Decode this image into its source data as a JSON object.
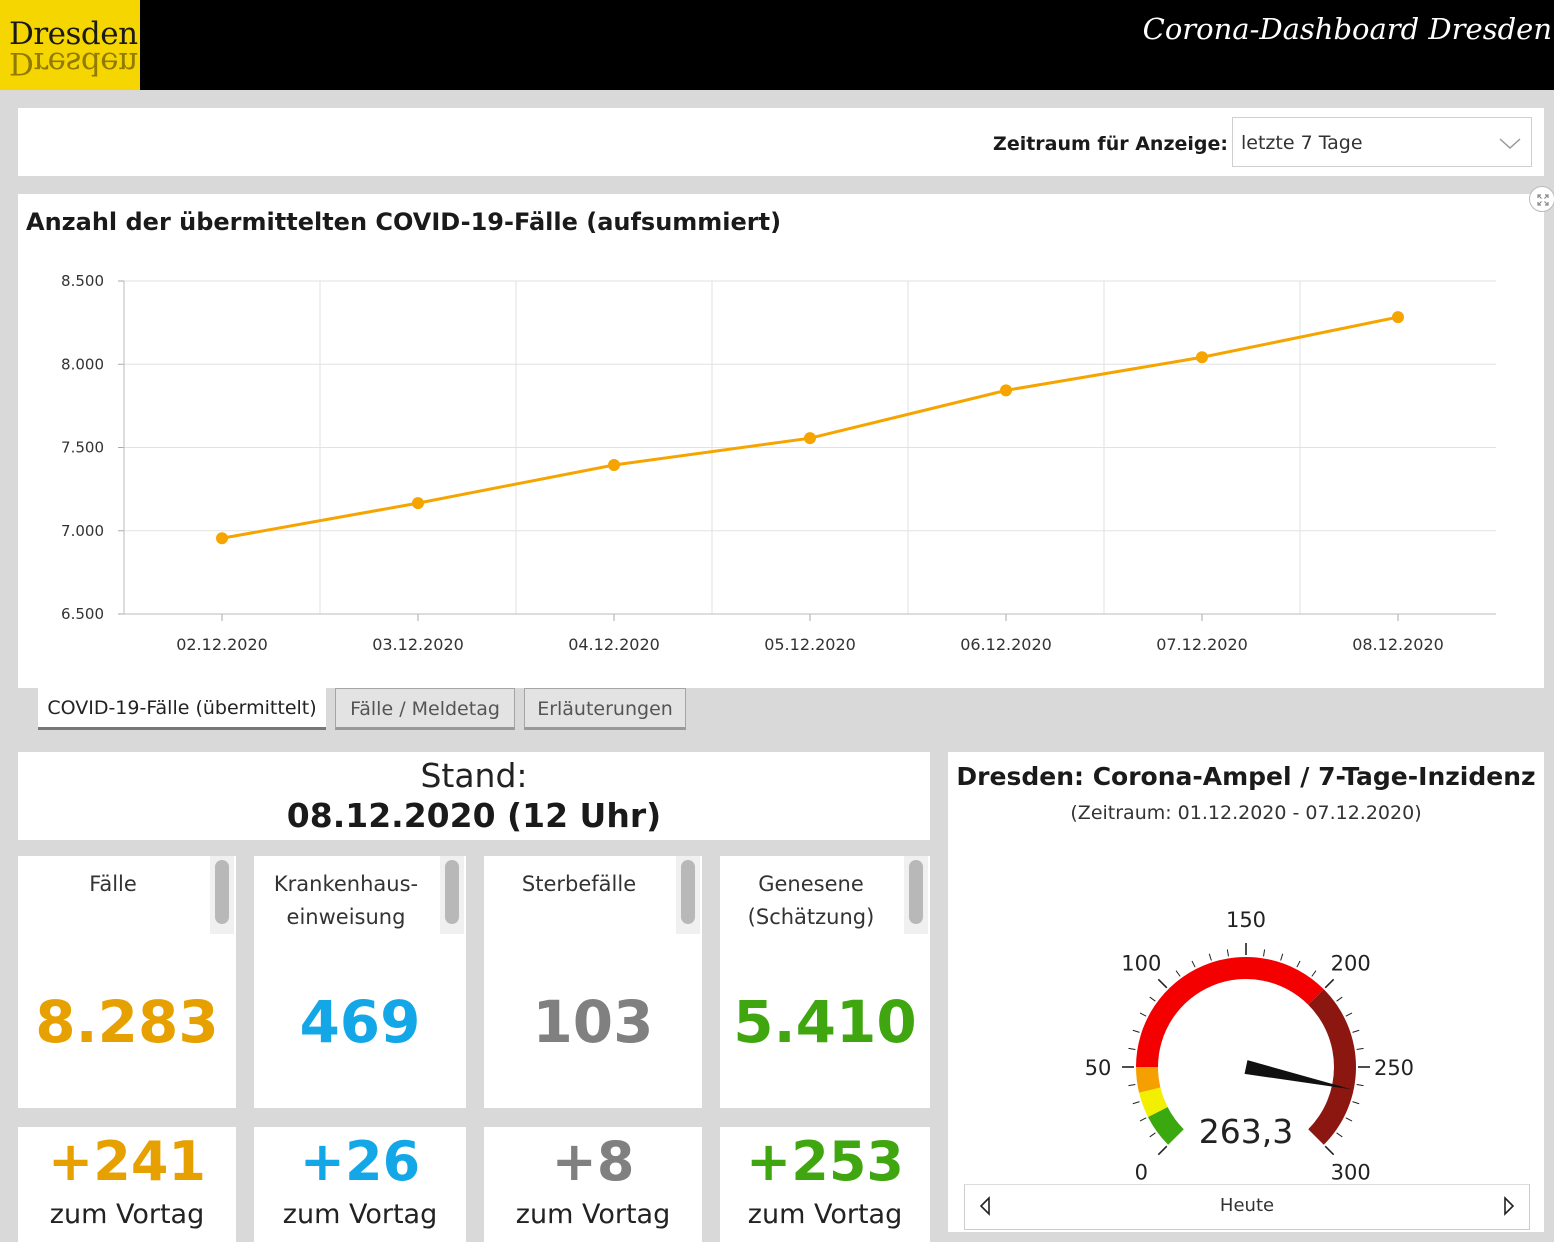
{
  "header": {
    "logo_text": "Dresden.",
    "title": "Corona-Dashboard Dresden"
  },
  "filter": {
    "label": "Zeitraum für Anzeige:",
    "selected": "letzte 7 Tage"
  },
  "chart_panel": {
    "title": "Anzahl der übermittelten COVID-19-Fälle (aufsummiert)"
  },
  "tabs": [
    {
      "label": "COVID-19-Fälle (übermittelt)",
      "active": true
    },
    {
      "label": "Fälle / Meldetag",
      "active": false
    },
    {
      "label": "Erläuterungen",
      "active": false
    }
  ],
  "stand": {
    "label": "Stand:",
    "date": "08.12.2020 (12 Uhr)"
  },
  "kpis": [
    {
      "label_lines": [
        "Fälle"
      ],
      "value": "8.283",
      "delta": "+241",
      "delta_label": "zum Vortag",
      "color": "#e6a000"
    },
    {
      "label_lines": [
        "Krankenhaus-",
        "einweisung"
      ],
      "value": "469",
      "delta": "+26",
      "delta_label": "zum Vortag",
      "color": "#13a7e8"
    },
    {
      "label_lines": [
        "Sterbefälle"
      ],
      "value": "103",
      "delta": "+8",
      "delta_label": "zum Vortag",
      "color": "#808080"
    },
    {
      "label_lines": [
        "Genesene",
        "(Schätzung)"
      ],
      "value": "5.410",
      "delta": "+253",
      "delta_label": "zum Vortag",
      "color": "#3fa60f"
    }
  ],
  "gauge": {
    "title": "Dresden: Corona-Ampel / 7-Tage-Inzidenz",
    "subtitle": "(Zeitraum: 01.12.2020 - 07.12.2020)",
    "value": 263.3,
    "value_label": "263,3",
    "min": 0,
    "max": 300,
    "tick_labels": [
      "0",
      "50",
      "100",
      "150",
      "200",
      "250",
      "300"
    ],
    "bands": [
      {
        "from": 0,
        "to": 20,
        "color": "#3aa80f"
      },
      {
        "from": 20,
        "to": 35,
        "color": "#f2ef00"
      },
      {
        "from": 35,
        "to": 50,
        "color": "#f5a000"
      },
      {
        "from": 50,
        "to": 200,
        "color": "#f50000"
      },
      {
        "from": 200,
        "to": 300,
        "color": "#8c1610"
      }
    ],
    "nav_label": "Heute"
  },
  "chart_data": {
    "type": "line",
    "title": "Anzahl der übermittelten COVID-19-Fälle (aufsummiert)",
    "categories": [
      "02.12.2020",
      "03.12.2020",
      "04.12.2020",
      "05.12.2020",
      "06.12.2020",
      "07.12.2020",
      "08.12.2020"
    ],
    "values": [
      6955,
      7166,
      7395,
      7556,
      7843,
      8042,
      8283
    ],
    "y_tick_labels": [
      "6.500",
      "7.000",
      "7.500",
      "8.000",
      "8.500"
    ],
    "ylim": [
      6500,
      8500
    ],
    "grid": true,
    "line_color": "#f5a400"
  }
}
